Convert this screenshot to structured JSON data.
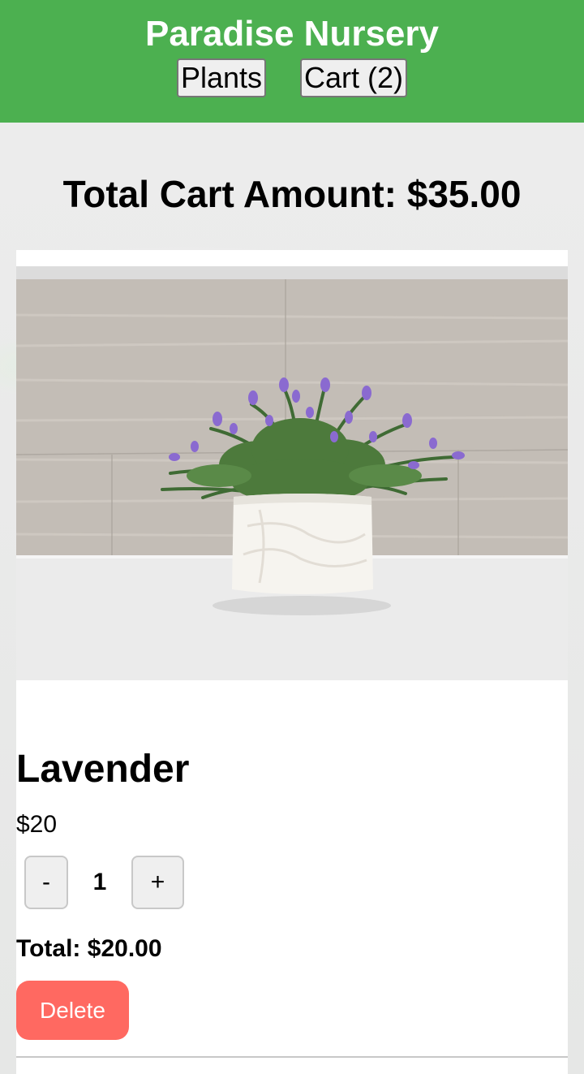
{
  "navbar": {
    "brand": "Paradise Nursery",
    "plants_label": "Plants",
    "cart_label": "Cart (2)"
  },
  "cart": {
    "total_text": "Total Cart Amount: $35.00"
  },
  "item": {
    "name": "Lavender",
    "price": "$20",
    "decrement_label": "-",
    "quantity": "1",
    "increment_label": "+",
    "total_text": "Total: $20.00",
    "delete_label": "Delete",
    "image_alt": "lavender in white pot"
  },
  "colors": {
    "navbar": "#4cb050",
    "delete_button": "#ff6961",
    "card_background": "#ffffff"
  }
}
